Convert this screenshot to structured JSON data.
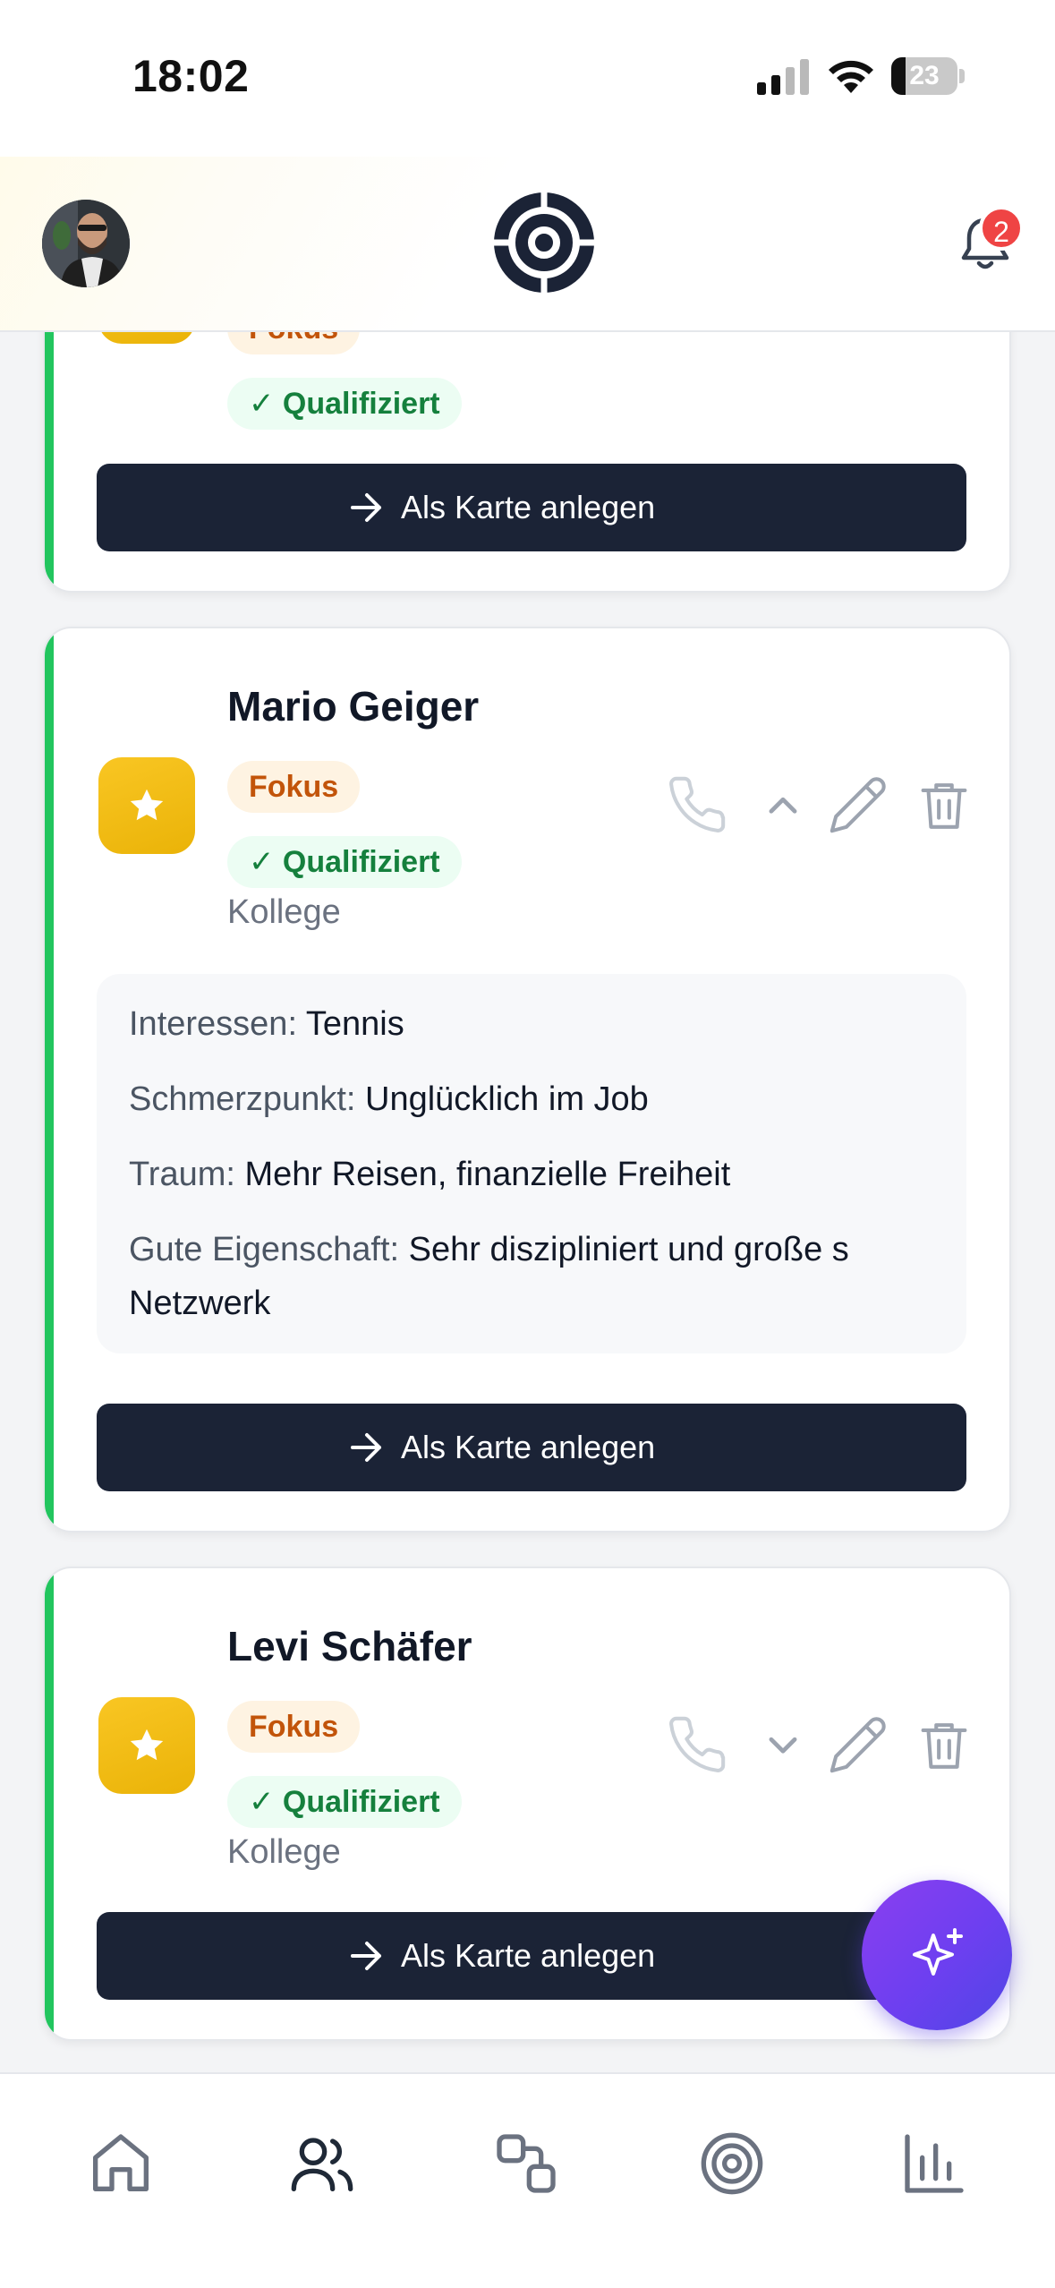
{
  "status_bar": {
    "time": "18:02",
    "battery": "23"
  },
  "header": {
    "notification_count": "2"
  },
  "cards": [
    {
      "badges": {
        "fokus": "Fokus",
        "qualified": "✓ Qualifiziert"
      },
      "cta_label": "Als Karte anlegen"
    },
    {
      "name": "Mario Geiger",
      "badges": {
        "fokus": "Fokus",
        "qualified": "✓ Qualifiziert"
      },
      "relation": "Kollege",
      "expanded": true,
      "details": [
        {
          "key": "Interessen:",
          "value": "Tennis"
        },
        {
          "key": "Schmerzpunkt:",
          "value": "Unglücklich im Job"
        },
        {
          "key": "Traum:",
          "value": "Mehr Reisen, finanzielle Freiheit"
        },
        {
          "key": "Gute Eigenschaft:",
          "value": "Sehr diszipliniert und große s Netzwerk"
        }
      ],
      "cta_label": "Als Karte anlegen"
    },
    {
      "name": "Levi Schäfer",
      "badges": {
        "fokus": "Fokus",
        "qualified": "✓ Qualifiziert"
      },
      "relation": "Kollege",
      "expanded": false,
      "cta_label": "Als Karte anlegen"
    }
  ],
  "icons": {
    "header": [
      "avatar",
      "target-logo-icon",
      "bell-icon"
    ],
    "card_actions": [
      "phone-icon",
      "chevron-icon",
      "pencil-icon",
      "trash-icon"
    ],
    "fab": "sparkles-icon",
    "tabs": [
      "home-icon",
      "users-icon",
      "cards-icon",
      "target-icon",
      "bar-chart-icon"
    ]
  },
  "colors": {
    "accent_green": "#22c55e",
    "star_yellow": "#eab308",
    "cta_dark": "#1b2336",
    "fab_purple": "#7c3aed",
    "notification_red": "#ef4444"
  }
}
